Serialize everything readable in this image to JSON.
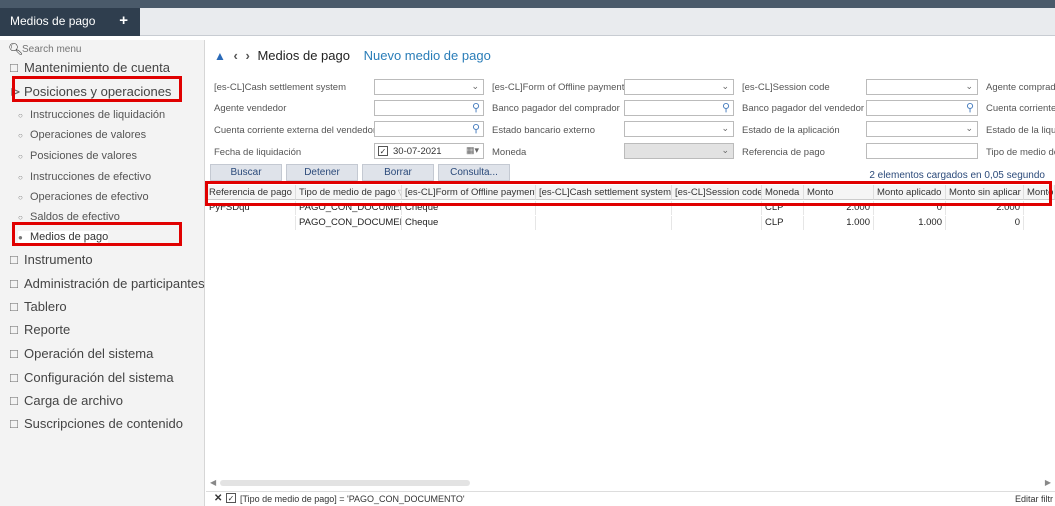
{
  "app": {
    "tab_label": "Medios de pago",
    "tab_add_icon": "plus-icon"
  },
  "sidebar": {
    "search_placeholder": "Search menu",
    "items": [
      {
        "label": "Mantenimiento de cuenta",
        "icon": "folder-icon"
      },
      {
        "label": "Posiciones y operaciones",
        "icon": "folder-open-icon"
      },
      {
        "label": "Instrucciones de liquidación"
      },
      {
        "label": "Operaciones de valores"
      },
      {
        "label": "Posiciones de valores"
      },
      {
        "label": "Instrucciones de efectivo"
      },
      {
        "label": "Operaciones de efectivo"
      },
      {
        "label": "Saldos de efectivo"
      },
      {
        "label": "Medios de pago"
      },
      {
        "label": "Instrumento",
        "icon": "folder-icon"
      },
      {
        "label": "Administración de participantes",
        "icon": "folder-icon"
      },
      {
        "label": "Tablero",
        "icon": "folder-icon"
      },
      {
        "label": "Reporte",
        "icon": "folder-icon"
      },
      {
        "label": "Operación del sistema",
        "icon": "folder-icon"
      },
      {
        "label": "Configuración del sistema",
        "icon": "folder-icon"
      },
      {
        "label": "Carga de archivo",
        "icon": "folder-icon"
      },
      {
        "label": "Suscripciones de contenido",
        "icon": "folder-icon"
      }
    ]
  },
  "main": {
    "title": "Medios de pago",
    "new_link": "Nuevo medio de pago",
    "filters": {
      "cash_settlement_system": "[es-CL]Cash settlement system",
      "form_offline_payment": "[es-CL]Form of Offline payment",
      "session_code": "[es-CL]Session code",
      "agente_comprador": "Agente comprado",
      "agente_vendedor": "Agente vendedor",
      "banco_pagador_comprador": "Banco pagador del comprador",
      "banco_pagador_vendedor": "Banco pagador del vendedor",
      "cuenta_corriente": "Cuenta corriente",
      "cuenta_corriente_externa": "Cuenta corriente externa del vendedor",
      "estado_bancario_externo": "Estado bancario externo",
      "estado_aplicacion": "Estado de la aplicación",
      "estado_liqui": "Estado de la liqui",
      "fecha_liquidacion": "Fecha de liquidación",
      "fecha_value": "30-07-2021",
      "moneda": "Moneda",
      "referencia_pago": "Referencia de pago",
      "tipo_medio": "Tipo de medio de"
    },
    "buttons": {
      "buscar": "Buscar",
      "detener": "Detener",
      "borrar": "Borrar",
      "consulta": "Consulta..."
    },
    "loaded_message": "2 elementos cargados en 0,05 segundo",
    "grid": {
      "columns": [
        "Referencia de pago",
        "Tipo de medio de pago",
        "[es-CL]Form of Offline payment",
        "[es-CL]Cash settlement system",
        "[es-CL]Session code",
        "Moneda",
        "Monto",
        "Monto aplicado",
        "Monto sin aplicar",
        "Monto l"
      ],
      "rows": [
        [
          "PyFSDqu",
          "PAGO_CON_DOCUMENTO",
          "Cheque",
          "",
          "",
          "CLP",
          "2.000",
          "0",
          "2.000",
          ""
        ],
        [
          "",
          "PAGO_CON_DOCUMENTO",
          "Cheque",
          "",
          "",
          "CLP",
          "1.000",
          "1.000",
          "0",
          ""
        ]
      ]
    },
    "filter_bar": {
      "expression": "[Tipo de medio de pago] = 'PAGO_CON_DOCUMENTO'",
      "edit_label": "Editar filtr"
    }
  },
  "colors": {
    "highlight": "#e00000",
    "accent": "#2a6ab8",
    "topbar": "#2f3e4e"
  }
}
